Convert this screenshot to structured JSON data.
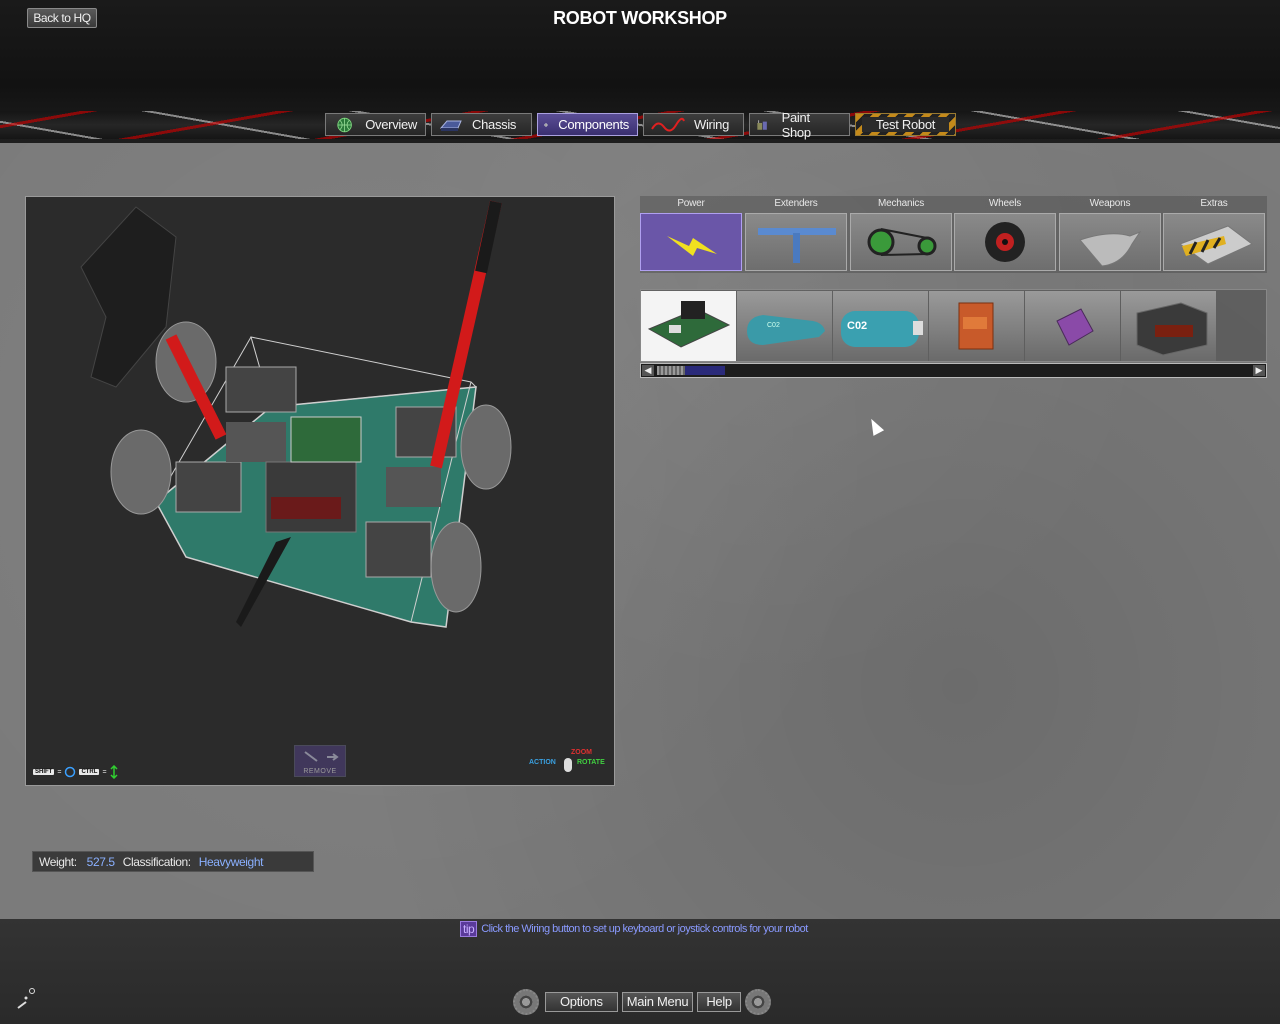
{
  "header": {
    "back_label": "Back to HQ",
    "title": "ROBOT WORKSHOP"
  },
  "tabs": [
    {
      "label": "Overview",
      "icon": "globe-icon"
    },
    {
      "label": "Chassis",
      "icon": "chassis-icon"
    },
    {
      "label": "Components",
      "icon": "gear-icon",
      "active": true
    },
    {
      "label": "Wiring",
      "icon": "wire-icon"
    },
    {
      "label": "Paint Shop",
      "icon": "paint-can-icon"
    },
    {
      "label": "Test Robot",
      "icon": ""
    }
  ],
  "viewport": {
    "hint_left": {
      "shift_key": "SHIFT",
      "ctrl_key": "CTRL"
    },
    "remove_label": "REMOVE",
    "hint_right": {
      "zoom": "ZOOM",
      "action": "ACTION",
      "rotate": "ROTATE"
    }
  },
  "categories": [
    {
      "label": "Power",
      "icon": "lightning-icon",
      "active": true
    },
    {
      "label": "Extenders",
      "icon": "t-bracket-icon"
    },
    {
      "label": "Mechanics",
      "icon": "chain-drive-icon"
    },
    {
      "label": "Wheels",
      "icon": "wheel-icon"
    },
    {
      "label": "Weapons",
      "icon": "blade-icon"
    },
    {
      "label": "Extras",
      "icon": "plow-icon"
    }
  ],
  "parts": [
    {
      "icon": "circuit-board-icon",
      "selected": true
    },
    {
      "icon": "gas-tank-icon",
      "text": "C02"
    },
    {
      "icon": "co2-tank-icon",
      "text": "C02"
    },
    {
      "icon": "battery-icon"
    },
    {
      "icon": "battery-pack-icon"
    },
    {
      "icon": "large-battery-icon"
    }
  ],
  "stats": {
    "weight_label": "Weight:",
    "weight_value": "527.5",
    "class_label": "Classification:",
    "class_value": "Heavyweight"
  },
  "tip": {
    "badge": "tip",
    "text": "Click the Wiring button to set up keyboard or joystick controls for your robot"
  },
  "footer": {
    "options": "Options",
    "main_menu": "Main Menu",
    "help": "Help"
  },
  "colors": {
    "accent": "#6a56a8",
    "highlight_text": "#8ab0ff",
    "tip_text": "#8a9aff"
  }
}
